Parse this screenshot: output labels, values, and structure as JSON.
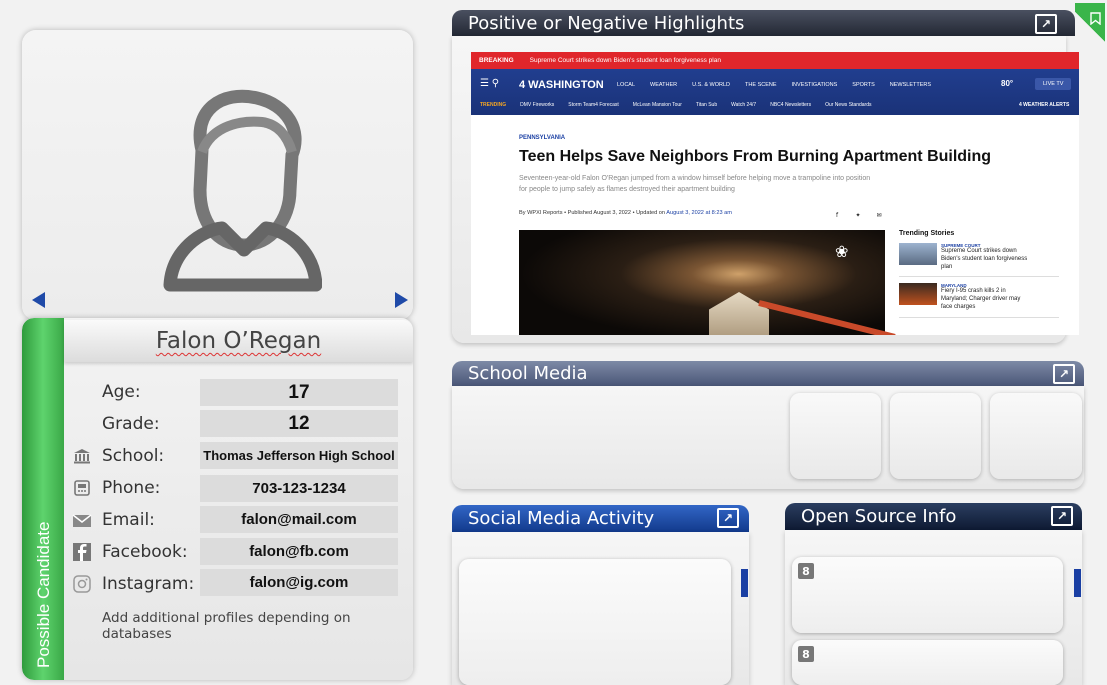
{
  "profile": {
    "name": "Falon O’Regan",
    "status_tab": "Possible Candidate",
    "fields": {
      "age_label": "Age:",
      "age_value": "17",
      "grade_label": "Grade:",
      "grade_value": "12",
      "school_label": "School:",
      "school_value": "Thomas Jefferson High School",
      "phone_label": "Phone:",
      "phone_value": "703-123-1234",
      "email_label": "Email:",
      "email_value": "falon@mail.com",
      "facebook_label": "Facebook:",
      "facebook_value": "falon@fb.com",
      "instagram_label": "Instagram:",
      "instagram_value": "falon@ig.com"
    },
    "note": "Add additional profiles depending on databases"
  },
  "panels": {
    "highlights_title": "Positive or Negative Highlights",
    "school_media_title": "School Media",
    "social_title": "Social Media Activity",
    "open_source_title": "Open Source Info"
  },
  "article": {
    "breaking_label": "BREAKING",
    "breaking_text": "Supreme Court strikes down Biden's student loan forgiveness plan",
    "brand": "4 WASHINGTON",
    "nav_links": [
      "LOCAL",
      "WEATHER",
      "U.S. & WORLD",
      "THE SCENE",
      "INVESTIGATIONS",
      "SPORTS",
      "NEWSLETTERS"
    ],
    "temperature": "80°",
    "live_tv": "LIVE TV",
    "trending_label": "TRENDING",
    "trending_links": [
      "DMV Fireworks",
      "Storm Team4 Forecast",
      "McLean Mansion Tour",
      "Titan Sub",
      "Watch 24/7",
      "NBC4 Newsletters",
      "Our News Standards"
    ],
    "weather_alerts": "4 WEATHER ALERTS",
    "kicker": "PENNSYLVANIA",
    "headline": "Teen Helps Save Neighbors From Burning Apartment Building",
    "dek": "Seventeen-year-old Falon O'Regan jumped from a window himself before helping move a trampoline into position for people to jump safely as flames destroyed their apartment building",
    "byline": "By WPXI Reports • Published August 3, 2022 • Updated on ",
    "byline_link": "August 3, 2022 at 8:23 am",
    "trending_header": "Trending Stories",
    "stories": [
      {
        "category": "SUPREME COURT",
        "title": "Supreme Court strikes down Biden's student loan forgiveness plan"
      },
      {
        "category": "MARYLAND",
        "title": "Fiery I-95 crash kills 2 in Maryland; Charger driver may face charges"
      }
    ]
  },
  "icons": {
    "school": "columns-icon",
    "phone": "phone-icon",
    "email": "envelope-icon",
    "facebook": "facebook-icon",
    "instagram": "instagram-icon",
    "google": "google-icon"
  },
  "colors": {
    "accent_green": "#3ab54a",
    "nav_blue": "#1f4aa8",
    "breaking_red": "#e0262b"
  }
}
